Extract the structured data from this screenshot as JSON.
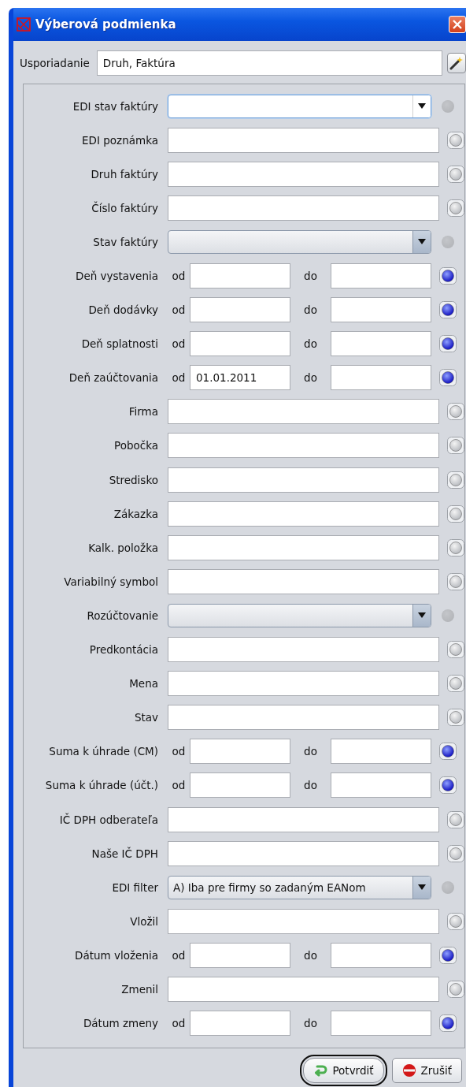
{
  "window": {
    "title": "Výberová podmienka"
  },
  "ordering": {
    "label": "Usporiadanie",
    "value": "Druh, Faktúra"
  },
  "filters": [
    {
      "kind": "combo",
      "label": "EDI stav faktúry",
      "focused": true,
      "enabled": false
    },
    {
      "kind": "text",
      "label": "EDI poznámka",
      "enabled": true,
      "active": false
    },
    {
      "kind": "text",
      "label": "Druh faktúry",
      "enabled": true,
      "active": false
    },
    {
      "kind": "text",
      "label": "Číslo faktúry",
      "enabled": true,
      "active": false
    },
    {
      "kind": "combo",
      "label": "Stav faktúry",
      "focused": false,
      "enabled": false
    },
    {
      "kind": "range",
      "label": "Deň vystavenia",
      "from_label": "od",
      "to_label": "do",
      "enabled": true,
      "active": true
    },
    {
      "kind": "range",
      "label": "Deň dodávky",
      "from_label": "od",
      "to_label": "do",
      "enabled": true,
      "active": true
    },
    {
      "kind": "range",
      "label": "Deň splatnosti",
      "from_label": "od",
      "to_label": "do",
      "enabled": true,
      "active": true
    },
    {
      "kind": "range",
      "label": "Deň zaúčtovania",
      "from_label": "od",
      "from": "01.01.2011",
      "to_label": "do",
      "enabled": true,
      "active": true
    },
    {
      "kind": "text",
      "label": "Firma",
      "enabled": true,
      "active": false
    },
    {
      "kind": "text",
      "label": "Pobočka",
      "enabled": true,
      "active": false
    },
    {
      "kind": "text",
      "label": "Stredisko",
      "enabled": true,
      "active": false
    },
    {
      "kind": "text",
      "label": "Zákazka",
      "enabled": true,
      "active": false
    },
    {
      "kind": "text",
      "label": "Kalk. položka",
      "enabled": true,
      "active": false
    },
    {
      "kind": "text",
      "label": "Variabilný symbol",
      "enabled": true,
      "active": false
    },
    {
      "kind": "combo",
      "label": "Rozúčtovanie",
      "focused": false,
      "enabled": false
    },
    {
      "kind": "text",
      "label": "Predkontácia",
      "enabled": true,
      "active": false
    },
    {
      "kind": "text",
      "label": "Mena",
      "enabled": true,
      "active": false
    },
    {
      "kind": "text",
      "label": "Stav",
      "enabled": true,
      "active": false
    },
    {
      "kind": "range",
      "label": "Suma k úhrade (CM)",
      "from_label": "od",
      "to_label": "do",
      "enabled": true,
      "active": true
    },
    {
      "kind": "range",
      "label": "Suma k úhrade (účt.)",
      "from_label": "od",
      "to_label": "do",
      "enabled": true,
      "active": true
    },
    {
      "kind": "text",
      "label": "IČ DPH odberateľa",
      "enabled": true,
      "active": false
    },
    {
      "kind": "text",
      "label": "Naše IČ DPH",
      "enabled": true,
      "active": false
    },
    {
      "kind": "combo",
      "label": "EDI filter",
      "value": "A) Iba pre firmy so zadaným EANom",
      "focused": false,
      "enabled": false
    },
    {
      "kind": "text",
      "label": "Vložil",
      "enabled": true,
      "active": false
    },
    {
      "kind": "range",
      "label": "Dátum vloženia",
      "from_label": "od",
      "to_label": "do",
      "enabled": true,
      "active": true
    },
    {
      "kind": "text",
      "label": "Zmenil",
      "enabled": true,
      "active": false
    },
    {
      "kind": "range",
      "label": "Dátum zmeny",
      "from_label": "od",
      "to_label": "do",
      "enabled": true,
      "active": true
    }
  ],
  "buttons": [
    {
      "kind": "confirm",
      "label": "Potvrdiť",
      "highlighted": true
    },
    {
      "kind": "cancel",
      "label": "Zrušiť",
      "highlighted": false
    }
  ]
}
